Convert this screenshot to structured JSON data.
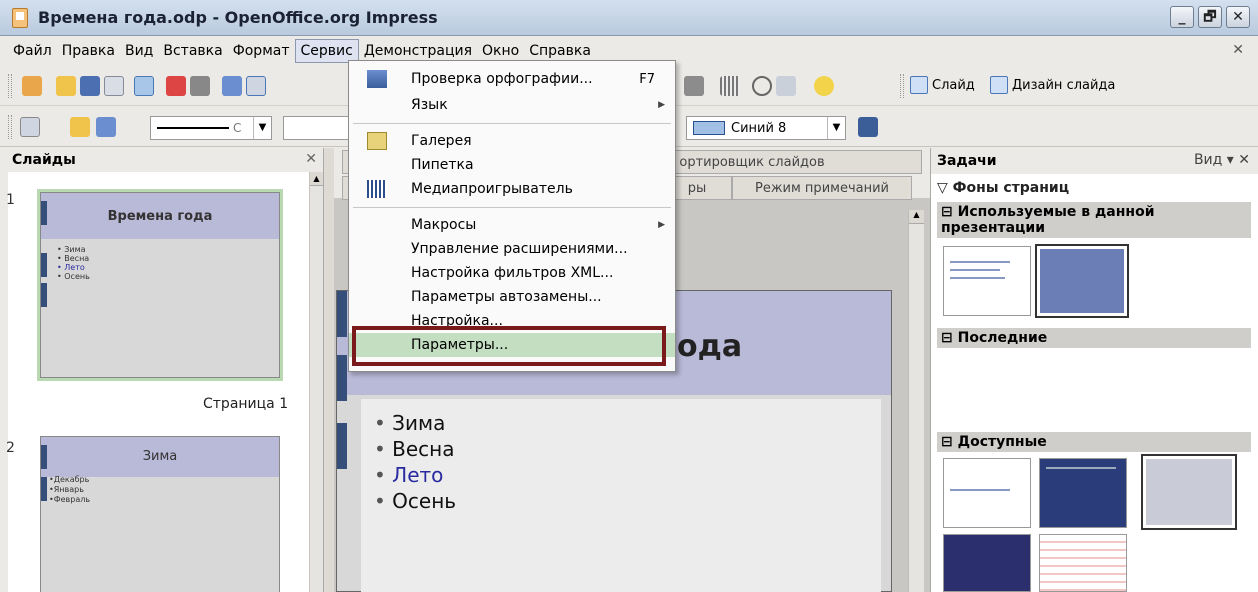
{
  "window": {
    "title": "Времена года.odp - OpenOffice.org Impress",
    "buttons": [
      "_",
      "🗗",
      "✕"
    ]
  },
  "menubar": {
    "items": [
      "Файл",
      "Правка",
      "Вид",
      "Вставка",
      "Формат",
      "Сервис",
      "Демонстрация",
      "Окно",
      "Справка"
    ],
    "close": "✕"
  },
  "toolbar": {
    "slide_label": "Слайд",
    "design_label": "Дизайн слайда",
    "color_value": "Синий 8",
    "line_style": "С"
  },
  "slides_pane": {
    "title": "Слайды",
    "close": "✕",
    "page_label": "Страница 1",
    "slides": [
      {
        "num": "1",
        "title": "Времена года",
        "bullets": [
          "• Зима",
          "• Весна",
          "• Лето",
          "• Осень"
        ]
      },
      {
        "num": "2",
        "title": "Зима",
        "bullets": [
          "•Декабрь",
          "•Январь",
          "•Февраль"
        ]
      }
    ]
  },
  "view_tabs": {
    "sorter": "ортировщик слайдов",
    "notes": "Режим примечаний",
    "partial": "ры"
  },
  "slide": {
    "title_partial": "ода",
    "bullets": [
      "Зима",
      "Весна",
      "Лето",
      "Осень"
    ]
  },
  "tasks": {
    "title": "Задачи",
    "view": "Вид ▾ ✕",
    "section": "▽ Фоны страниц",
    "used": "⊟ Используемые в данной презентации",
    "recent": "⊟ Последние",
    "available": "⊟ Доступные"
  },
  "service_menu": {
    "spellcheck": "Проверка орфографии...",
    "spellcheck_key": "F7",
    "language": "Язык",
    "gallery": "Галерея",
    "eyedropper": "Пипетка",
    "media": "Медиапроигрыватель",
    "macros": "Макросы",
    "extensions": "Управление расширениями...",
    "xml_filters": "Настройка фильтров XML...",
    "autocorrect": "Параметры автозамены...",
    "customize": "Настройка...",
    "options": "Параметры..."
  }
}
